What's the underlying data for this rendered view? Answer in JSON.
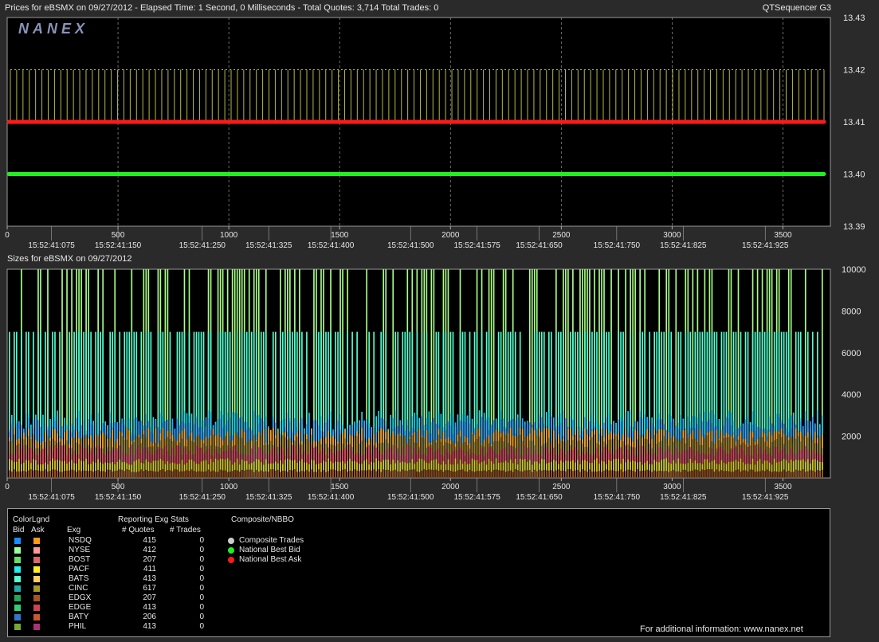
{
  "header": {
    "title_line": "Prices for  eBSMX  on  09/27/2012  -  Elapsed Time: 1 Second, 0 Milliseconds  -  Total Quotes: 3,714  Total Trades: 0",
    "app_name": "QTSequencer G3"
  },
  "logo_text": "NANEX",
  "sizes_title": "Sizes for  eBSMX  on  09/27/2012",
  "colors": {
    "bid_line": "#ff1a1a",
    "nbbo_bid": "#22ee22",
    "spikes": "#b8b84a",
    "panel_bg": "#000000",
    "outer_bg": "#2a2a2a"
  },
  "chart_data": [
    {
      "type": "line",
      "title": "Prices for  eBSMX  on  09/27/2012",
      "x_range": [
        0,
        3714
      ],
      "x_ticks": [
        0,
        500,
        1000,
        1500,
        2000,
        2500,
        3000,
        3500
      ],
      "time_labels": [
        {
          "x": 200,
          "label": "15:52:41:075"
        },
        {
          "x": 500,
          "label": "15:52:41:150"
        },
        {
          "x": 880,
          "label": "15:52:41:250"
        },
        {
          "x": 1180,
          "label": "15:52:41:325"
        },
        {
          "x": 1460,
          "label": "15:52:41:400"
        },
        {
          "x": 1820,
          "label": "15:52:41:500"
        },
        {
          "x": 2120,
          "label": "15:52:41:575"
        },
        {
          "x": 2400,
          "label": "15:52:41:650"
        },
        {
          "x": 2750,
          "label": "15:52:41:750"
        },
        {
          "x": 3050,
          "label": "15:52:41:825"
        },
        {
          "x": 3420,
          "label": "15:52:41:925"
        }
      ],
      "y_range": [
        13.39,
        13.43
      ],
      "y_ticks": [
        "13.43",
        "13.42",
        "13.41",
        "13.40",
        "13.39"
      ],
      "series": [
        {
          "name": "National Best Ask",
          "value": 13.41,
          "color": "#ff1a1a"
        },
        {
          "name": "National Best Bid",
          "value": 13.4,
          "color": "#22ee22"
        }
      ],
      "spikes": {
        "low": 13.41,
        "high": 13.42,
        "count": 130,
        "color": "#b8b84a"
      }
    },
    {
      "type": "bar",
      "title": "Sizes for  eBSMX  on  09/27/2012",
      "x_range": [
        0,
        3714
      ],
      "x_ticks": [
        0,
        500,
        1000,
        1500,
        2000,
        2500,
        3000,
        3500
      ],
      "y_range": [
        0,
        10000
      ],
      "y_ticks": [
        "10000",
        "8000",
        "6000",
        "4000",
        "2000"
      ],
      "layers": [
        {
          "level": 10000,
          "color": "#aaff88"
        },
        {
          "level": 7000,
          "color": "#55ffd0"
        },
        {
          "level": 3100,
          "color": "#22d8ee"
        },
        {
          "level": 2800,
          "color": "#3aa0ff"
        },
        {
          "level": 2300,
          "color": "#ff9a1a"
        },
        {
          "level": 2000,
          "color": "#9a7a2a"
        },
        {
          "level": 1500,
          "color": "#d04060"
        },
        {
          "level": 900,
          "color": "#c8c820"
        },
        {
          "level": 400,
          "color": "#884422"
        }
      ]
    }
  ],
  "legend": {
    "colorlgnd_label": "ColorLgnd",
    "bid_label": "Bid",
    "ask_label": "Ask",
    "exg_label": "Exg",
    "stats_label": "Reporting Exg Stats",
    "quotes_label": "# Quotes",
    "trades_label": "# Trades",
    "composite_label": "Composite/NBBO",
    "rows": [
      {
        "exg": "NSDQ",
        "quotes": "415",
        "trades": "0",
        "bid": "#1a8cff",
        "ask": "#ff9a1a"
      },
      {
        "exg": "NYSE",
        "quotes": "412",
        "trades": "0",
        "bid": "#99ff99",
        "ask": "#ff9999"
      },
      {
        "exg": "BOST",
        "quotes": "207",
        "trades": "0",
        "bid": "#66dd66",
        "ask": "#dd6666"
      },
      {
        "exg": "PACF",
        "quotes": "411",
        "trades": "0",
        "bid": "#22eeee",
        "ask": "#ffee22"
      },
      {
        "exg": "BATS",
        "quotes": "413",
        "trades": "0",
        "bid": "#55ffd0",
        "ask": "#ffd060"
      },
      {
        "exg": "CINC",
        "quotes": "617",
        "trades": "0",
        "bid": "#22a8a8",
        "ask": "#a89a22"
      },
      {
        "exg": "EDGX",
        "quotes": "207",
        "trades": "0",
        "bid": "#22a855",
        "ask": "#a85522"
      },
      {
        "exg": "EDGE",
        "quotes": "413",
        "trades": "0",
        "bid": "#33cc77",
        "ask": "#cc4455"
      },
      {
        "exg": "BATY",
        "quotes": "206",
        "trades": "0",
        "bid": "#3377cc",
        "ask": "#cc5533"
      },
      {
        "exg": "PHIL",
        "quotes": "413",
        "trades": "0",
        "bid": "#77aa33",
        "ask": "#aa3377"
      }
    ],
    "composite_items": [
      {
        "label": "Composite Trades",
        "color": "#cccccc"
      },
      {
        "label": "National Best Bid",
        "color": "#22ee22"
      },
      {
        "label": "National Best Ask",
        "color": "#ff1a1a"
      }
    ],
    "footer": "For additional information: www.nanex.net"
  }
}
